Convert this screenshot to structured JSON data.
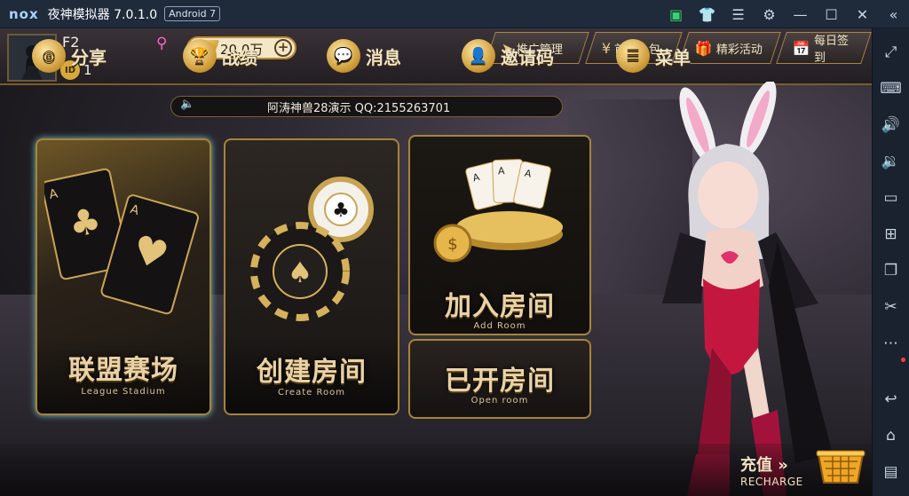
{
  "emulator": {
    "logo": "nox",
    "title": "夜神模拟器 7.0.1.0",
    "android_badge": "Android 7",
    "titlebar_icons": [
      "store-icon",
      "shirt-icon",
      "menu-icon",
      "settings-icon",
      "minimize-icon",
      "maximize-icon",
      "close-icon",
      "collapse-icon"
    ],
    "sidebar_icons": [
      "fullscreen-icon",
      "keyboard-icon",
      "volume-up-icon",
      "volume-down-icon",
      "screen-icon",
      "apk-install-icon",
      "multi-instance-icon",
      "screenshot-scissors-icon",
      "more-icon",
      "back-icon",
      "home-icon",
      "recent-apps-icon"
    ]
  },
  "player": {
    "name": "F2",
    "id_label": "ID",
    "id_value": "1",
    "coins": "20.0万"
  },
  "top_menu": {
    "promo": "推广管理",
    "recharge_gift": "首充礼包",
    "events": "精彩活动",
    "daily_signin": "每日签到"
  },
  "marquee": {
    "text": "阿涛神兽28演示  QQ:2155263701"
  },
  "cards": {
    "league": {
      "title": "联盟赛场",
      "subtitle": "League Stadium"
    },
    "create": {
      "title": "创建房间",
      "subtitle": "Create Room"
    },
    "join": {
      "title": "加入房间",
      "subtitle": "Add Room"
    },
    "open": {
      "title": "已开房间",
      "subtitle": "Open room"
    }
  },
  "bottom_bar": {
    "share": "分享",
    "record": "战绩",
    "message": "消息",
    "invite_code": "邀请码",
    "menu": "菜单",
    "recharge_cn": "充值 »",
    "recharge_en": "RECHARGE"
  },
  "colors": {
    "gold": "#a88439",
    "title_text": "#e9d2a6",
    "emulator_bar": "#1f2a3a"
  }
}
